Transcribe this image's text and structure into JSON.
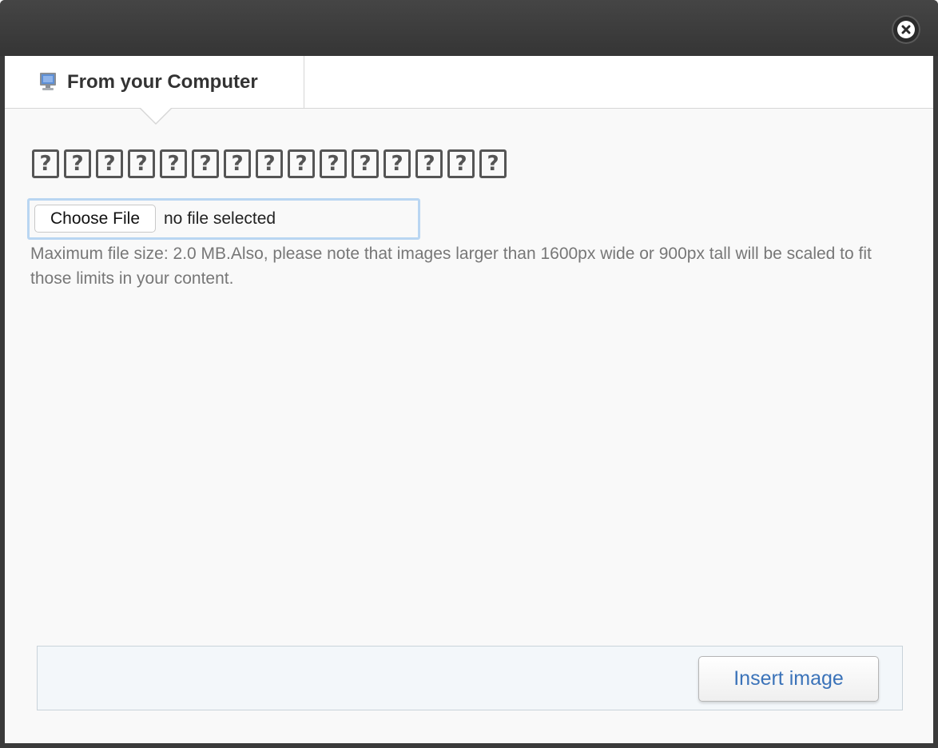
{
  "dialog": {
    "close_icon": "close-icon"
  },
  "tabs": [
    {
      "label": "From your Computer",
      "icon": "computer-icon",
      "active": true
    }
  ],
  "upload": {
    "heading_glyph": "?",
    "heading_glyph_count": 15,
    "choose_file_label": "Choose File",
    "file_status": "no file selected",
    "help_text": "Maximum file size: 2.0 MB.Also, please note that images larger than 1600px wide or 900px tall will be scaled to fit those limits in your content."
  },
  "footer": {
    "insert_label": "Insert image"
  },
  "colors": {
    "titlebar": "#3d3d3d",
    "focus_ring": "#b9d6f2",
    "link_blue": "#3b73b9",
    "help_text": "#777777"
  }
}
